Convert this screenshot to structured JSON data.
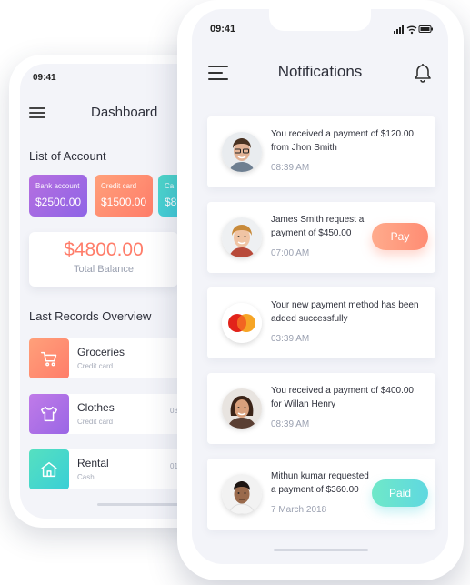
{
  "dashboard": {
    "status_time": "09:41",
    "title": "Dashboard",
    "accounts_heading": "List of Account",
    "accounts": [
      {
        "label": "Bank account",
        "amount": "$2500.00"
      },
      {
        "label": "Credit card",
        "amount": "$1500.00"
      },
      {
        "label": "Ca",
        "amount": "$8"
      }
    ],
    "total_balance": {
      "amount": "$4800.00",
      "label": "Total Balance"
    },
    "records_heading": "Last Records Overview",
    "records": [
      {
        "name": "Groceries",
        "method": "Credit card",
        "date": "",
        "icon": "cart-icon"
      },
      {
        "name": "Clothes",
        "method": "Credit card",
        "date": "03/",
        "icon": "shirt-icon"
      },
      {
        "name": "Rental",
        "method": "Cash",
        "date": "01/",
        "icon": "house-icon"
      }
    ],
    "colors": {
      "accent_orange": "#ff7d6a",
      "accent_purple": "#8e64e6",
      "accent_teal": "#39cfd6"
    }
  },
  "notifications": {
    "status_time": "09:41",
    "title": "Notifications",
    "items": [
      {
        "message": "You received a payment of $120.00 from Jhon Smith",
        "time": "08:39 AM",
        "action": ""
      },
      {
        "message": "James Smith request a payment of $450.00",
        "time": "07:00 AM",
        "action": "Pay"
      },
      {
        "message": "Your new payment method has been added successfully",
        "time": "03:39 AM",
        "action": ""
      },
      {
        "message": "You received a payment of $400.00 for Willan Henry",
        "time": "08:39 AM",
        "action": ""
      },
      {
        "message": "Mithun kumar requested a payment of $360.00",
        "time": "7 March 2018",
        "action": "Paid"
      }
    ],
    "mastercard_logo_text": "MasterCard"
  }
}
